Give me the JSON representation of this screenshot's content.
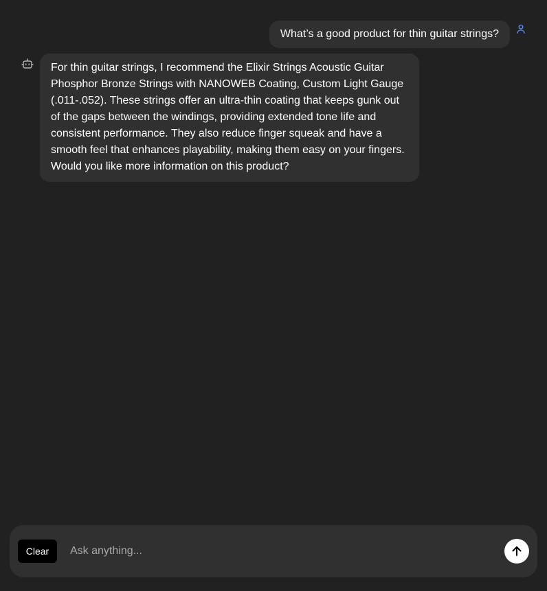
{
  "conversation": {
    "user_message": "What’s a good product for thin guitar strings?",
    "bot_message": "For thin guitar strings, I recommend the Elixir Strings Acoustic Guitar Phosphor Bronze Strings with NANOWEB Coating, Custom Light Gauge (.011-.052). These strings offer an ultra-thin coating that keeps gunk out of the gaps between the windings, providing extended tone life and consistent performance. They also reduce finger squeak and have a smooth feel that enhances playability, making them easy on your fingers. Would you like more information on this product?"
  },
  "composer": {
    "clear_label": "Clear",
    "input_value": "",
    "placeholder": "Ask anything...",
    "send_icon": "arrow-up-icon"
  },
  "icons": {
    "user": "user-icon",
    "bot": "bot-icon"
  },
  "colors": {
    "background": "#212121",
    "bubble": "#303030",
    "user_icon": "#5b8def",
    "bot_icon": "#b4b4b4",
    "clear_button": "#000000",
    "send_button": "#ffffff"
  }
}
